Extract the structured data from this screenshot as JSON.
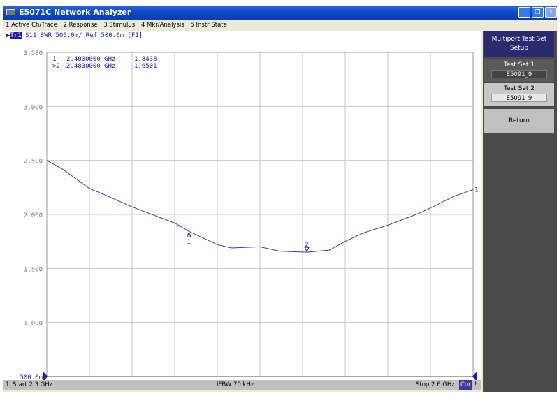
{
  "window": {
    "title": "E5071C Network Analyzer"
  },
  "menu": [
    "1 Active Ch/Trace",
    "2 Response",
    "3 Stimulus",
    "4 Mkr/Analysis",
    "5 Instr State"
  ],
  "trace_header": {
    "trace": "Tr1",
    "text": "S11  SWR 500.0m/ Ref 500.0m [F1]"
  },
  "markers": [
    {
      "label": "1",
      "freq": "2.4000000 GHz",
      "value": "1.8438"
    },
    {
      "label": ">2",
      "freq": "2.4830000 GHz",
      "value": "1.6501"
    }
  ],
  "status": {
    "channel": "1",
    "start": "Start 2.3 GHz",
    "ifbw": "IFBW 70 kHz",
    "stop": "Stop 2.6 GHz",
    "cor": "Cor",
    "extra": "!"
  },
  "softkeys": {
    "title": "Multiport Test Set Setup",
    "test_set_1": {
      "label": "Test Set 1",
      "value": "E5091_9"
    },
    "test_set_2": {
      "label": "Test Set 2",
      "value": "E5091_9"
    },
    "return": "Return"
  },
  "colors": {
    "trace": "#3232c8",
    "text": "#1e1ea0",
    "softkey_title": "#2a2a6e"
  },
  "chart_data": {
    "type": "line",
    "xlim": [
      2.3,
      2.6
    ],
    "ylim": [
      0.5,
      3.5
    ],
    "ytick_labels": [
      "3.500",
      "3.000",
      "2.500",
      "2.000",
      "1.500",
      "1.000",
      "500.0m"
    ],
    "yticks": [
      3.5,
      3.0,
      2.5,
      2.0,
      1.5,
      1.0,
      0.5
    ],
    "grid": true,
    "trace_end_label": "1",
    "marker_points": [
      {
        "label": "1",
        "x": 2.4,
        "y": 1.8438
      },
      {
        "label": "2",
        "x": 2.483,
        "y": 1.6501
      }
    ],
    "x": [
      2.3,
      2.311,
      2.33,
      2.341,
      2.36,
      2.37,
      2.39,
      2.4,
      2.42,
      2.43,
      2.45,
      2.464,
      2.483,
      2.499,
      2.51,
      2.523,
      2.54,
      2.562,
      2.57,
      2.587,
      2.6
    ],
    "y": [
      2.5,
      2.42,
      2.24,
      2.18,
      2.07,
      2.02,
      1.92,
      1.8438,
      1.72,
      1.69,
      1.7,
      1.66,
      1.6501,
      1.67,
      1.75,
      1.83,
      1.9,
      2.01,
      2.06,
      2.17,
      2.23
    ]
  }
}
